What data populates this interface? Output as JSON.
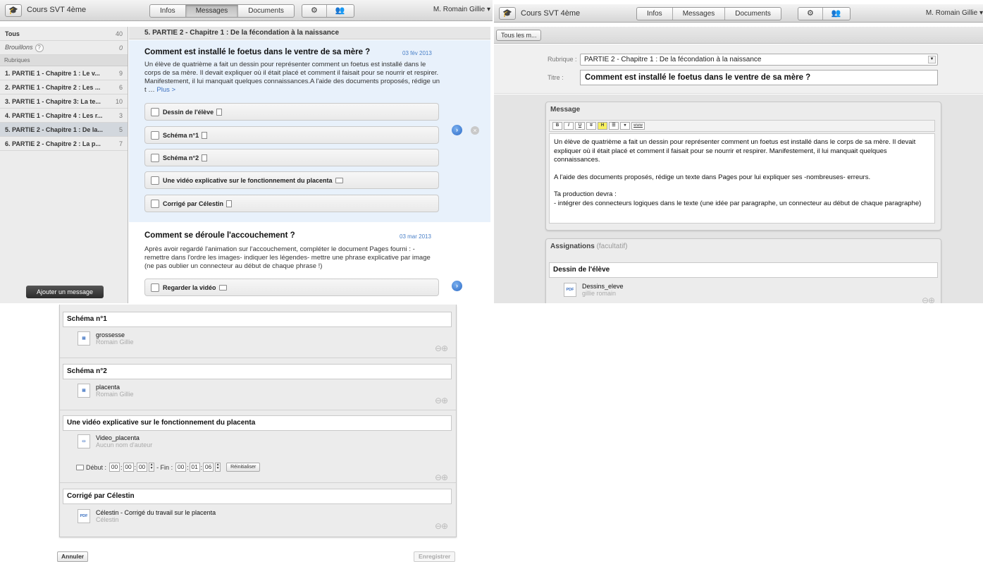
{
  "app": {
    "title": "Cours SVT 4ème",
    "tabs": [
      "Infos",
      "Messages",
      "Documents"
    ],
    "selected_tab": "Messages",
    "user": "M. Romain Gillie ▾"
  },
  "sidebar": {
    "all_label": "Tous",
    "all_count": "40",
    "drafts_label": "Brouillons",
    "drafts_help": "?",
    "drafts_count": "0",
    "section_label": "Rubriques",
    "items": [
      {
        "label": "1. PARTIE 1 - Chapitre 1 : Le v...",
        "count": "9"
      },
      {
        "label": "2. PARTIE 1 - Chapitre 2 : Les ...",
        "count": "6"
      },
      {
        "label": "3. PARTIE 1 - Chapitre 3: La te...",
        "count": "10"
      },
      {
        "label": "4. PARTIE 1 - Chapitre 4 : Les r...",
        "count": "3"
      },
      {
        "label": "5. PARTIE 2 - Chapitre 1 : De la...",
        "count": "5"
      },
      {
        "label": "6. PARTIE 2 - Chapitre 2 : La p...",
        "count": "7"
      }
    ],
    "add_button": "Ajouter un message"
  },
  "main": {
    "header": "5. PARTIE 2 - Chapitre 1 : De la fécondation à la naissance",
    "messages": [
      {
        "title": "Comment est installé le foetus dans le ventre de sa mère ?",
        "date": "03 fév 2013",
        "body": "Un élève de quatrième a fait un dessin pour représenter comment un foetus est installé dans le corps de sa mère. Il devait expliquer où il était placé et comment il faisait pour se nourrir et respirer. Manifestement, il lui manquait quelques connaissances.A l'aide des documents proposés, rédige un t …",
        "more": "Plus >",
        "items": [
          "Dessin de l'élève",
          "Schéma n°1",
          "Schéma n°2",
          "Une vidéo explicative sur le fonctionnement du placenta",
          "Corrigé par Célestin"
        ]
      },
      {
        "title": "Comment se déroule l'accouchement ?",
        "date": "03 mar 2013",
        "body": "Après avoir regardé l'animation sur l'accouchement, compléter le document Pages fourni : - remettre dans l'ordre les images- indiquer les légendes- mettre une phrase explicative par image (ne pas oublier un connecteur au début  de chaque phrase !)",
        "items": [
          "Regarder la vidéo"
        ]
      }
    ]
  },
  "editor": {
    "back_label": "Tous les m...",
    "rubrique_label": "Rubrique :",
    "rubrique_value": "PARTIE 2 - Chapitre 1 : De la fécondation à la naissance",
    "titre_label": "Titre :",
    "titre_value": "Comment est installé le foetus dans le ventre de sa mère ?",
    "message_label": "Message",
    "toolbar": [
      "B",
      "I",
      "U",
      "∓",
      "H",
      "☰",
      "▾",
      "www"
    ],
    "paragraphs": [
      "Un élève de quatrième a fait un dessin pour représenter comment un foetus est installé dans le corps de sa mère. Il devait expliquer où il était placé et comment il faisait pour se nourrir et respirer. Manifestement, il lui manquait quelques connaissances.",
      "A l'aide des documents proposés, rédige un texte dans Pages pour lui expliquer ses -nombreuses- erreurs.",
      "Ta production devra :",
      "- intégrer des connecteurs logiques dans le texte (une idée par paragraphe, un connecteur au début de chaque paragraphe)"
    ],
    "assign_label": "Assignations",
    "assign_optional": "(facultatif)",
    "assignments": [
      {
        "title": "Dessin de l'élève",
        "file": "Dessins_eleve",
        "author": "gillie romain",
        "icon": "PDF"
      },
      {
        "title": "Schéma n°1",
        "file": "grossesse",
        "author": "Romain Gillie",
        "icon": "doc"
      },
      {
        "title": "Schéma n°2",
        "file": "placenta",
        "author": "Romain Gillie",
        "icon": "doc"
      },
      {
        "title": "Une vidéo explicative sur le fonctionnement du placenta",
        "file": "Video_placenta",
        "author": "Aucun nom d'auteur",
        "icon": "video"
      },
      {
        "title": "Corrigé par Célestin",
        "file": "Célestin - Corrigé du travail sur le placenta",
        "author": "Célestin",
        "icon": "PDF"
      }
    ],
    "video_timer": {
      "start_label": "Début :",
      "start": [
        "00",
        "00",
        "00"
      ],
      "end_label": "- Fin :",
      "end": [
        "00",
        "01",
        "06"
      ],
      "reset": "Réinitialiser"
    },
    "cancel": "Annuler",
    "save": "Enregistrer"
  }
}
